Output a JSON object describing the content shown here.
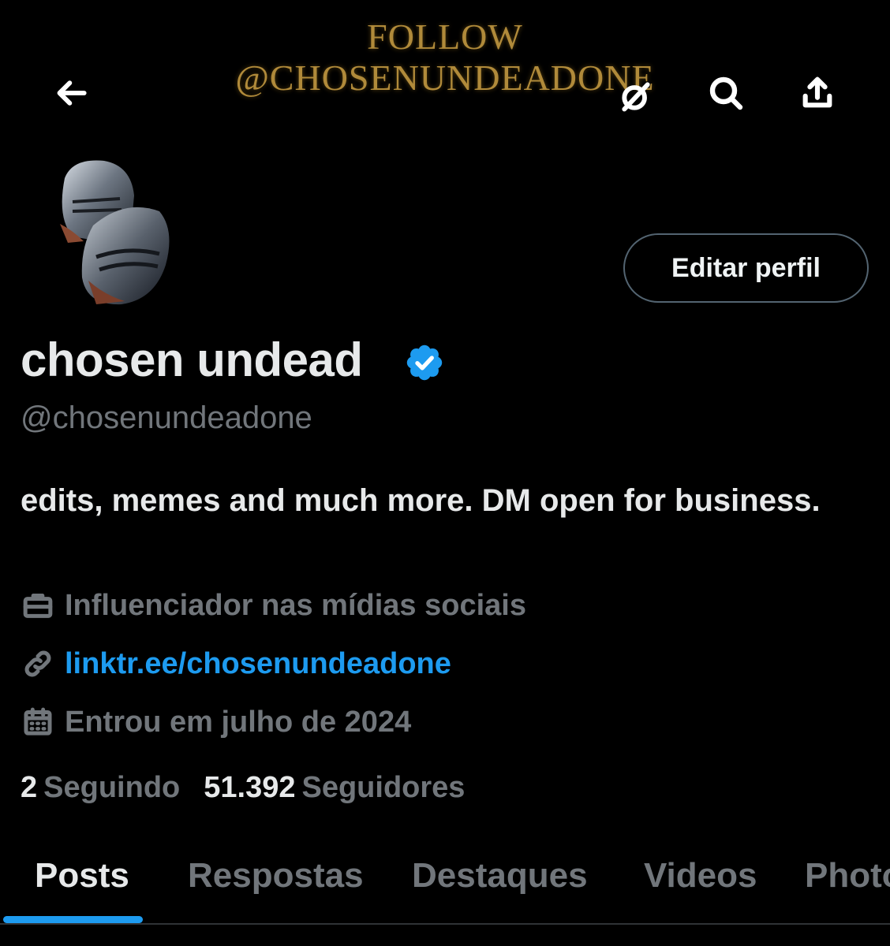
{
  "banner": {
    "line1": "FOLLOW",
    "line2": "@CHOSENUNDEADONE"
  },
  "topbar": {
    "icons": [
      "back-arrow-icon",
      "grok-icon",
      "search-icon",
      "share-icon"
    ]
  },
  "profile": {
    "display_name": "chosen undead",
    "verified": true,
    "handle": "@chosenundeadone",
    "edit_button": "Editar perfil",
    "bio": "edits, memes and much more. DM open for business.",
    "category": "Influenciador nas mídias sociais",
    "link": "linktr.ee/chosenundeadone",
    "joined": "Entrou em julho de 2024"
  },
  "stats": {
    "following_count": "2",
    "following_label": "Seguindo",
    "followers_count": "51.392",
    "followers_label": "Seguidores"
  },
  "tabs": [
    {
      "label": "Posts",
      "active": true
    },
    {
      "label": "Respostas",
      "active": false
    },
    {
      "label": "Destaques",
      "active": false
    },
    {
      "label": "Videos",
      "active": false
    },
    {
      "label": "Photos",
      "active": false
    }
  ],
  "colors": {
    "background": "#000000",
    "accent": "#1d9bf0",
    "text_primary": "#e7e9ea",
    "text_secondary": "#71767b"
  }
}
